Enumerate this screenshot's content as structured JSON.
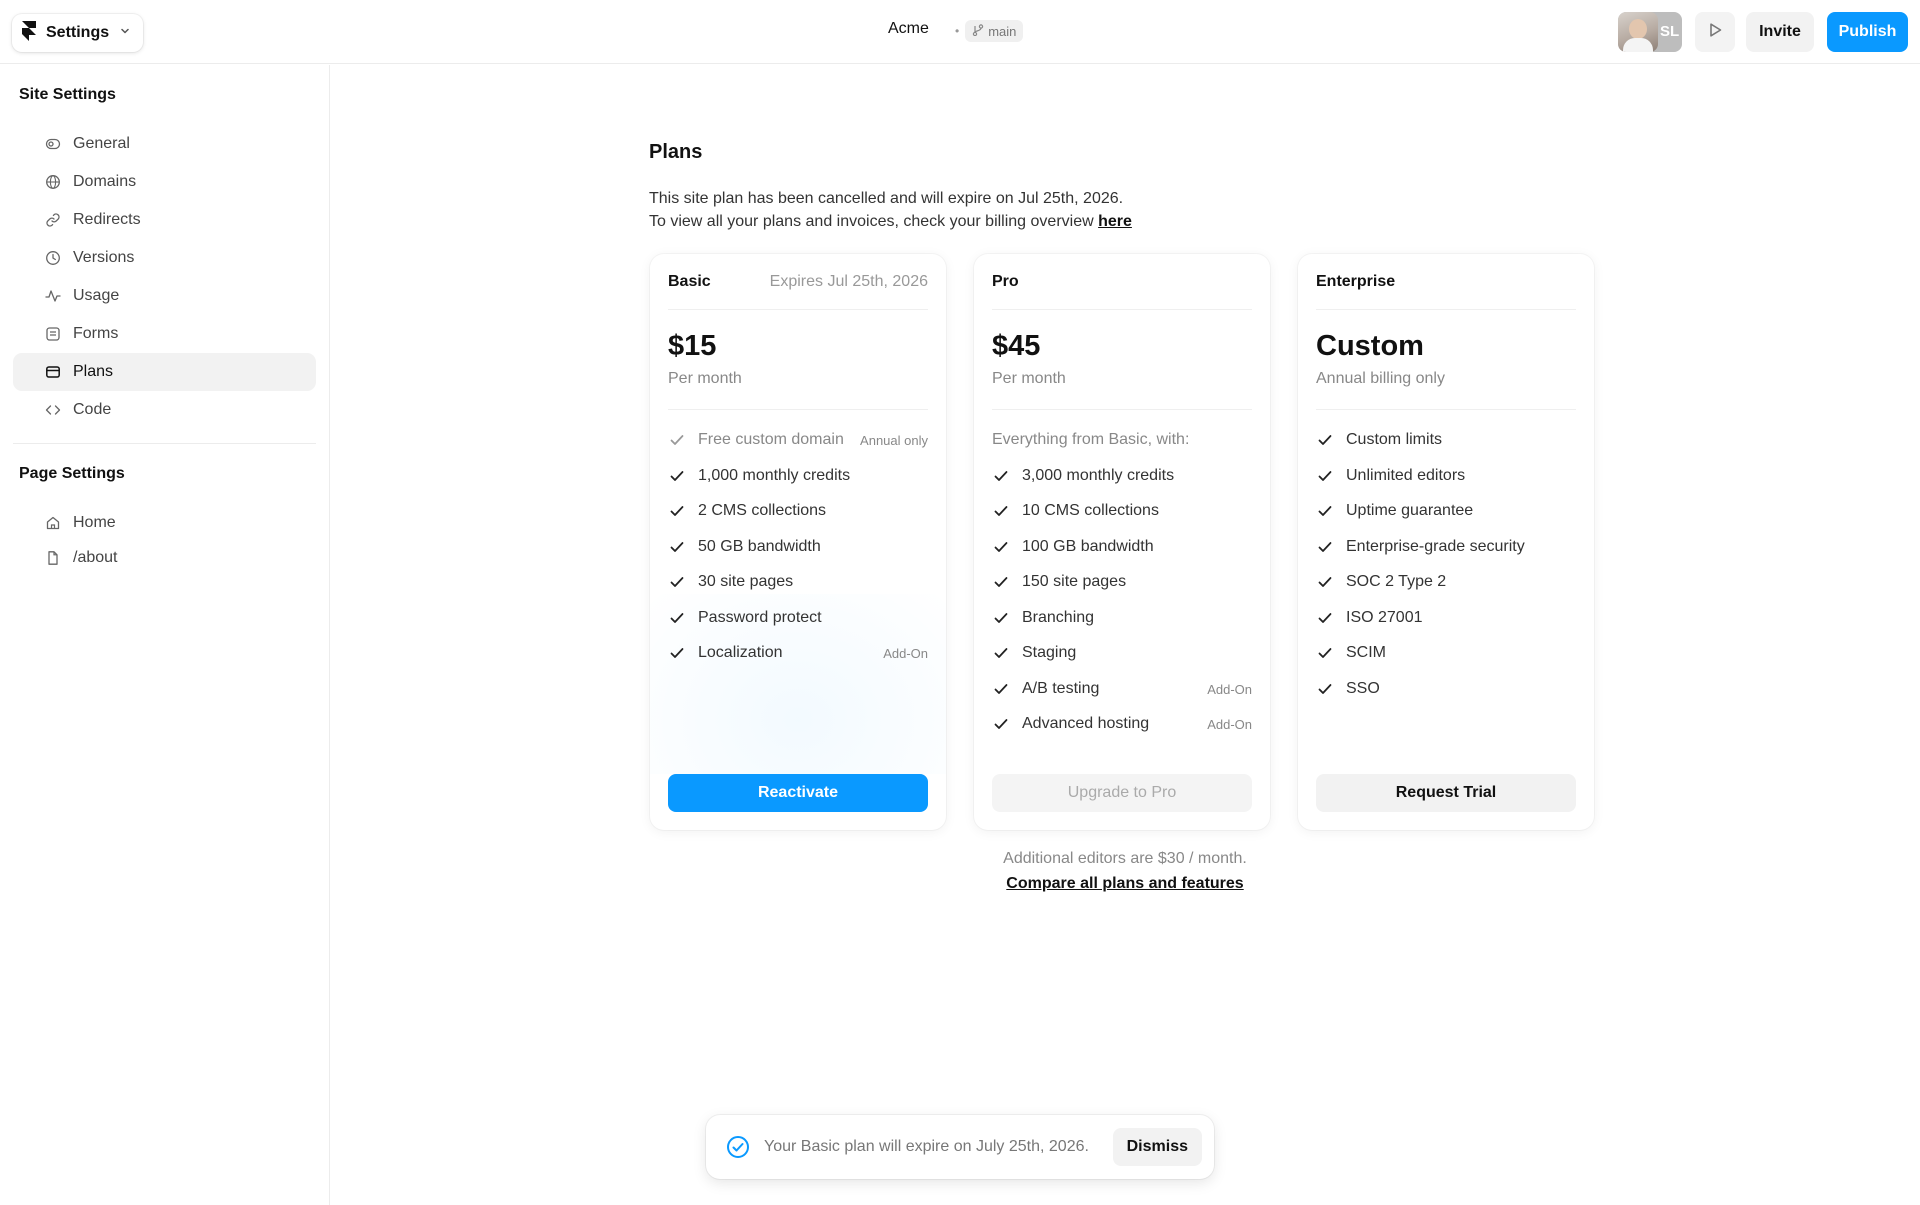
{
  "topbar": {
    "menu_label": "Settings",
    "project_title": "Acme",
    "branch": "main",
    "avatar_initials": "SL",
    "invite_label": "Invite",
    "publish_label": "Publish"
  },
  "sidebar": {
    "site_title": "Site Settings",
    "site_items": [
      {
        "label": "General",
        "icon": "toggle-icon"
      },
      {
        "label": "Domains",
        "icon": "globe-icon"
      },
      {
        "label": "Redirects",
        "icon": "link-icon"
      },
      {
        "label": "Versions",
        "icon": "clock-icon"
      },
      {
        "label": "Usage",
        "icon": "activity-icon"
      },
      {
        "label": "Forms",
        "icon": "form-icon"
      },
      {
        "label": "Plans",
        "icon": "card-icon",
        "active": true
      },
      {
        "label": "Code",
        "icon": "code-icon"
      }
    ],
    "page_title": "Page Settings",
    "page_items": [
      {
        "label": "Home",
        "icon": "home-icon"
      },
      {
        "label": "/about",
        "icon": "file-icon"
      }
    ]
  },
  "main": {
    "title": "Plans",
    "desc_line1": "This site plan has been cancelled and will expire on Jul 25th, 2026.",
    "desc_line2": "To view all your plans and invoices, check your billing overview ",
    "desc_link": "here",
    "extra_note": "Additional editors are $30 / month.",
    "compare_link": "Compare all plans and features"
  },
  "plans": [
    {
      "name": "Basic",
      "expires": "Expires Jul 25th, 2026",
      "price": "$15",
      "period": "Per month",
      "features": [
        {
          "text": "Free custom domain",
          "tag": "Annual only",
          "muted": true
        },
        {
          "text": "1,000 monthly credits"
        },
        {
          "text": "2 CMS collections"
        },
        {
          "text": "50 GB bandwidth"
        },
        {
          "text": "30 site pages"
        },
        {
          "text": "Password protect"
        },
        {
          "text": "Localization",
          "tag": "Add-On"
        }
      ],
      "cta": "Reactivate"
    },
    {
      "name": "Pro",
      "price": "$45",
      "period": "Per month",
      "intro": "Everything from Basic, with:",
      "features": [
        {
          "text": "3,000 monthly credits"
        },
        {
          "text": "10 CMS collections"
        },
        {
          "text": "100 GB bandwidth"
        },
        {
          "text": "150 site pages"
        },
        {
          "text": "Branching"
        },
        {
          "text": "Staging"
        },
        {
          "text": "A/B testing",
          "tag": "Add-On"
        },
        {
          "text": "Advanced hosting",
          "tag": "Add-On"
        }
      ],
      "cta": "Upgrade to Pro"
    },
    {
      "name": "Enterprise",
      "price": "Custom",
      "period": "Annual billing only",
      "features": [
        {
          "text": "Custom limits"
        },
        {
          "text": "Unlimited editors"
        },
        {
          "text": "Uptime guarantee"
        },
        {
          "text": "Enterprise-grade security"
        },
        {
          "text": "SOC 2 Type 2"
        },
        {
          "text": "ISO 27001"
        },
        {
          "text": "SCIM"
        },
        {
          "text": "SSO"
        }
      ],
      "cta": "Request Trial"
    }
  ],
  "toast": {
    "message": "Your Basic plan will expire on July 25th, 2026.",
    "dismiss_label": "Dismiss"
  },
  "colors": {
    "accent": "#0a99ff",
    "text": "#111111",
    "muted": "#888888"
  }
}
